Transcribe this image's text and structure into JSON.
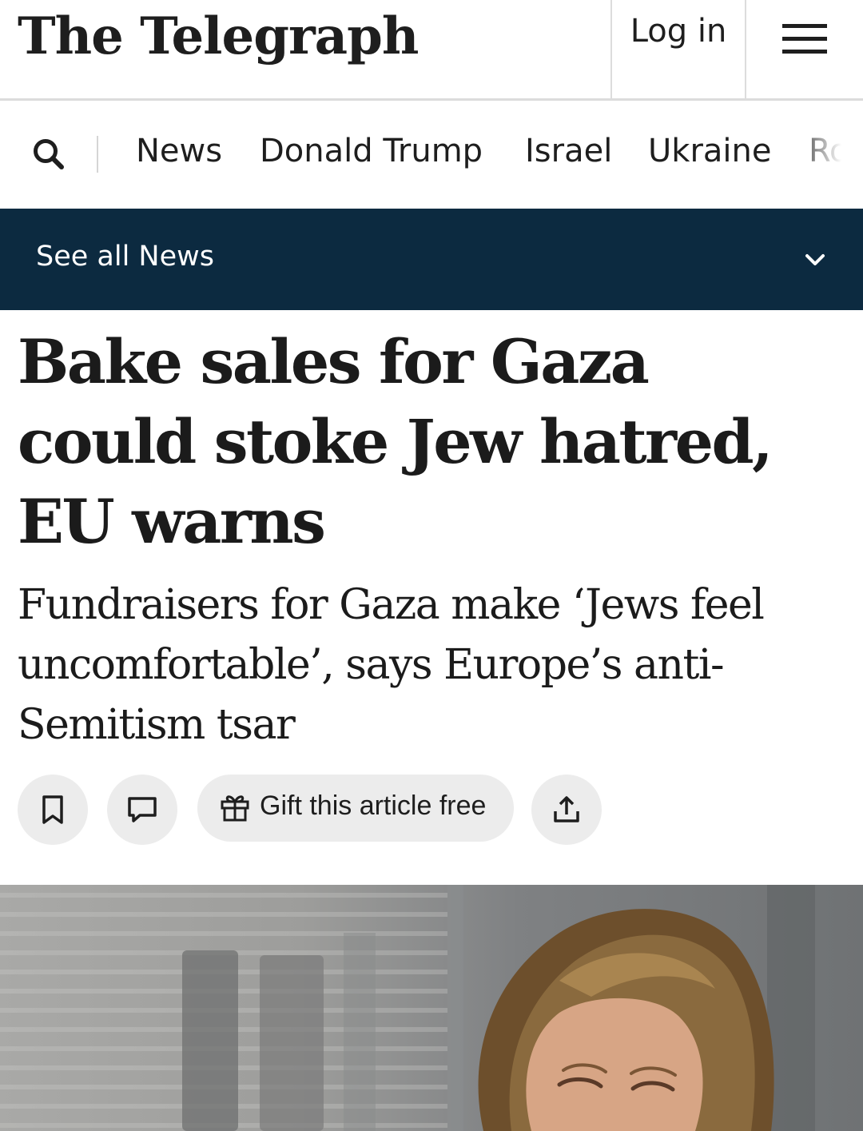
{
  "masthead": {
    "logo_text": "The Telegraph",
    "login_label": "Log in",
    "menu_icon": "hamburger-menu-icon"
  },
  "nav": {
    "search_icon": "search-icon",
    "items": [
      "News",
      "Donald Trump",
      "Israel",
      "Ukraine",
      "Ro"
    ]
  },
  "section_bar": {
    "label": "See all News",
    "icon": "chevron-down-icon",
    "background": "#0c2a40"
  },
  "article": {
    "headline": "Bake sales for Gaza could stoke Jew hatred, EU warns",
    "standfirst": "Fundraisers for Gaza make ‘Jews feel uncomfortable’, says Europe’s anti-Semitism tsar"
  },
  "actions": {
    "bookmark_icon": "bookmark-icon",
    "comment_icon": "comment-icon",
    "gift_icon": "gift-icon",
    "gift_label": "Gift this article free",
    "share_icon": "share-icon"
  },
  "photo": {
    "description_icon": "article-photo"
  }
}
